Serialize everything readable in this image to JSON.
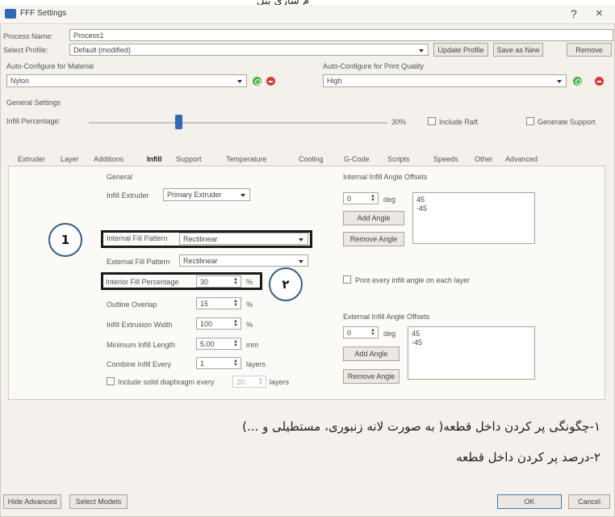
{
  "top_caption": "م سازی پیل ",
  "window": {
    "title": "FFF Settings",
    "help": "?",
    "close": "×"
  },
  "process": {
    "label": "Process Name:",
    "value": "Process1"
  },
  "profile": {
    "label": "Select Profile:",
    "value": "Default (modified)",
    "buttons": [
      "Update Profile",
      "Save as New",
      "Remove"
    ]
  },
  "auto_material": {
    "label": "Auto-Configure for Material",
    "value": "Nylon"
  },
  "auto_quality": {
    "label": "Auto-Configure for Print Quality",
    "value": "High"
  },
  "general_settings": {
    "label": "General Settings",
    "infill_label": "Infill Percentage:",
    "infill_value": "30%",
    "infill_fraction": 0.3,
    "include_raft": "Include Raft",
    "generate_support": "Generate Support"
  },
  "tabs": [
    "Extruder",
    "Layer",
    "Additions",
    "Infill",
    "Support",
    "Temperature",
    "Cooling",
    "G-Code",
    "Scripts",
    "Speeds",
    "Other",
    "Advanced"
  ],
  "active_tab": "Infill",
  "infill": {
    "general_label": "General",
    "infill_extruder_label": "Infill Extruder",
    "infill_extruder_value": "Primary Extruder",
    "internal_pattern_label": "Internal Fill Pattern",
    "internal_pattern_value": "Rectilinear",
    "external_pattern_label": "External Fill Pattern",
    "external_pattern_value": "Rectilinear",
    "interior_pct_label": "Interior Fill Percentage",
    "interior_pct_value": "30",
    "interior_pct_unit": "%",
    "outline_overlap_label": "Outline Overlap",
    "outline_overlap_value": "15",
    "outline_overlap_unit": "%",
    "extrusion_width_label": "Infill Extrusion Width",
    "extrusion_width_value": "100",
    "extrusion_width_unit": "%",
    "min_length_label": "Minimum Infill Length",
    "min_length_value": "5.00",
    "min_length_unit": "mm",
    "combine_label": "Combine Infill Every",
    "combine_value": "1",
    "combine_unit": "layers",
    "diaphragm_label": "Include solid diaphragm every",
    "diaphragm_value": "20",
    "diaphragm_unit": "layers"
  },
  "internal_angles": {
    "label": "Internal Infill Angle Offsets",
    "spin_value": "0",
    "unit": "deg",
    "add_button": "Add Angle",
    "remove_button": "Remove Angle",
    "values": [
      "45",
      "-45"
    ],
    "print_every_label": "Print every infill angle on each layer"
  },
  "external_angles": {
    "label": "External Infill Angle Offsets",
    "spin_value": "0",
    "unit": "deg",
    "add_button": "Add Angle",
    "remove_button": "Remove Angle",
    "values": [
      "45",
      "-45"
    ]
  },
  "callouts": [
    "1",
    "۲"
  ],
  "notes": [
    "۱-چگونگی پر کردن داخل قطعه( به صورت لانه زنبوری، مستطیلی و ...)",
    "۲-درصد پر کردن داخل قطعه"
  ],
  "bottom": {
    "hide_advanced": "Hide Advanced",
    "select_models": "Select Models",
    "ok": "OK",
    "cancel": "Cancel"
  },
  "colors": {
    "accent": "#2f6ab3",
    "ok_green": "#4bb543",
    "remove_red": "#d63a3a",
    "callout_border": "#2f5f8a"
  }
}
